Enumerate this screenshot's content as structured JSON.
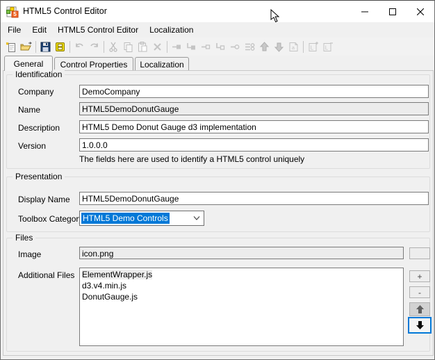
{
  "window": {
    "title": "HTML5 Control Editor",
    "controls": [
      "minimize",
      "maximize",
      "close"
    ]
  },
  "menu": {
    "items": [
      "File",
      "Edit",
      "HTML5 Control Editor",
      "Localization"
    ]
  },
  "toolbar": {
    "icons": [
      "new",
      "open",
      "save",
      "deploy",
      "undo",
      "redo",
      "cut",
      "copy",
      "paste",
      "delete",
      "link-filled",
      "anchor-filled",
      "link-hollow",
      "anchor-hollow",
      "link-circle",
      "properties",
      "move-up",
      "move-down",
      "export",
      "add-locale",
      "remove-locale"
    ]
  },
  "tabs": [
    {
      "label": "General",
      "active": true
    },
    {
      "label": "Control Properties",
      "active": false
    },
    {
      "label": "Localization",
      "active": false
    }
  ],
  "general": {
    "identification": {
      "title": "Identification",
      "fields": [
        {
          "label": "Company",
          "value": "DemoCompany",
          "readonly": false
        },
        {
          "label": "Name",
          "value": "HTML5DemoDonutGauge",
          "readonly": true
        },
        {
          "label": "Description",
          "value": "HTML5 Demo Donut Gauge d3 implementation",
          "readonly": false
        },
        {
          "label": "Version",
          "value": "1.0.0.0",
          "readonly": false
        }
      ],
      "note": "The fields here are used to identify a HTML5 control uniquely"
    },
    "presentation": {
      "title": "Presentation",
      "display_name": {
        "label": "Display Name",
        "value": "HTML5DemoDonutGauge"
      },
      "toolbox_category": {
        "label": "Toolbox Category",
        "value": "HTML5 Demo Controls"
      }
    },
    "files": {
      "title": "Files",
      "image": {
        "label": "Image",
        "value": "icon.png"
      },
      "additional_files": {
        "label": "Additional Files",
        "items": [
          "ElementWrapper.js",
          "d3.v4.min.js",
          "DonutGauge.js"
        ],
        "selected_index": 0
      },
      "buttons": {
        "add": "+",
        "remove": "-"
      }
    }
  },
  "colors": {
    "selection": "#0078d7",
    "focus_border": "#0078d7",
    "window_bg": "#f0f0f0",
    "titlebar_bg": "#ffffff"
  }
}
